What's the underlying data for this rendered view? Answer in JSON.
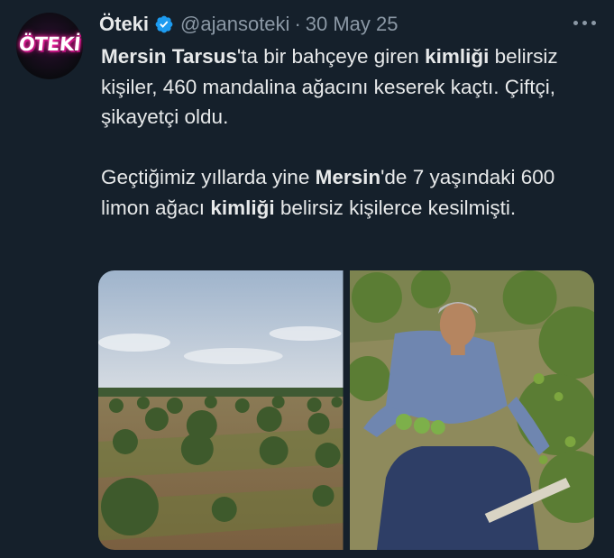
{
  "tweet": {
    "author": {
      "display_name": "Öteki",
      "handle": "@ajansoteki",
      "avatar_text": "ÖTEKİ",
      "verified": true
    },
    "separator": "·",
    "date": "30 May 25",
    "text": {
      "p1": {
        "s1": "Mersin Tarsus",
        "s2": "'ta bir bahçeye giren ",
        "s3": "kimliği",
        "s4": " belirsiz kişiler, 460 mandalina ağacını keserek kaçtı. Çiftçi, şikayetçi oldu."
      },
      "p2": {
        "s1": "Geçtiğimiz yıllarda yine ",
        "s2": "Mersin",
        "s3": "'de 7 yaşındaki 600 limon ağacı ",
        "s4": "kimliği",
        "s5": " belirsiz kişilerce kesilmişti."
      }
    },
    "media": [
      {
        "description_icon": "orchard-photo"
      },
      {
        "description_icon": "farmer-with-lemons-photo"
      }
    ]
  },
  "colors": {
    "background": "#15202b",
    "text_primary": "#e7e9ea",
    "text_secondary": "#8b98a5",
    "verified_badge": "#1d9bf0",
    "avatar_glow": "#ff2aa8"
  }
}
